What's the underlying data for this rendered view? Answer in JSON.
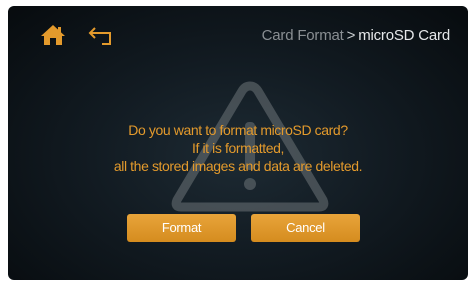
{
  "header": {
    "breadcrumb_parent": "Card Format",
    "breadcrumb_separator": ">",
    "breadcrumb_current": "microSD Card"
  },
  "icons": {
    "home": "home-icon",
    "back": "back-arrow-icon",
    "background": "warning-triangle-icon"
  },
  "dialog": {
    "line1": "Do you want to format microSD card?",
    "line2": "If it is formatted,",
    "line3": "all the stored images and data are deleted."
  },
  "buttons": {
    "format_label": "Format",
    "cancel_label": "Cancel"
  },
  "colors": {
    "accent": "#e39a2c",
    "button": "#dc952b",
    "background": "#121b22"
  }
}
